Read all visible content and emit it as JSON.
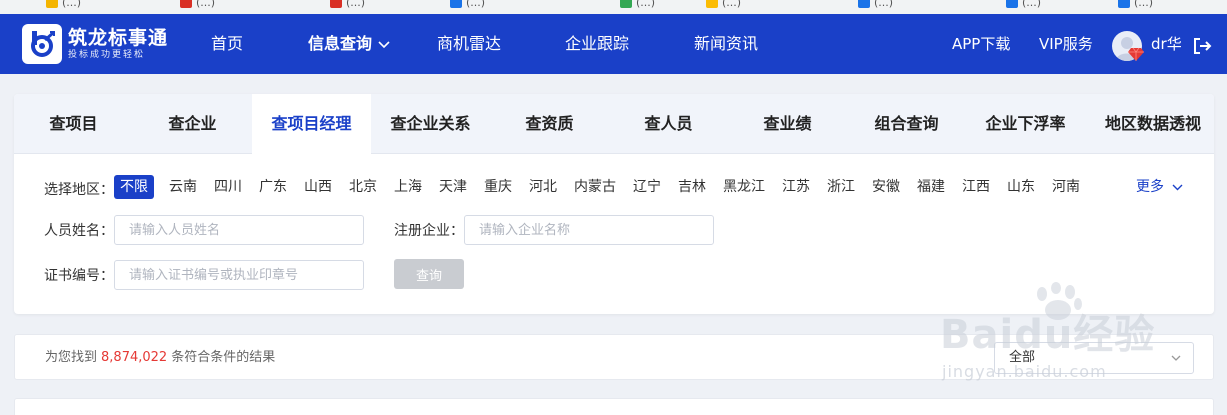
{
  "bookmarks": [
    {
      "label": "(...)",
      "color": "#f4b400"
    },
    {
      "label": "(...)",
      "color": "#d93025"
    },
    {
      "label": "(...)",
      "color": "#d93025"
    },
    {
      "label": "(...)",
      "color": "#1a73e8"
    },
    {
      "label": "(...)",
      "color": "#34a853"
    },
    {
      "label": "(...)",
      "color": "#fbbc04"
    },
    {
      "label": "(...)",
      "color": "#1a73e8"
    },
    {
      "label": "(...)",
      "color": "#1a73e8"
    },
    {
      "label": "(...)",
      "color": "#1a73e8"
    }
  ],
  "brand": {
    "title": "筑龙标事通",
    "subtitle": "投标成功更轻松",
    "color": "#1a40c8"
  },
  "nav": {
    "items": [
      "首页",
      "信息查询",
      "商机雷达",
      "企业跟踪",
      "新闻资讯"
    ],
    "active_index": 1,
    "app_download": "APP下载",
    "vip": "VIP服务",
    "username": "dr华",
    "logout_icon": "logout-icon"
  },
  "tabs": {
    "items": [
      "查项目",
      "查企业",
      "查项目经理",
      "查企业关系",
      "查资质",
      "查人员",
      "查业绩",
      "组合查询",
      "企业下浮率",
      "地区数据透视"
    ],
    "active_index": 2
  },
  "filters": {
    "region_label": "选择地区：",
    "regions": [
      "不限",
      "云南",
      "四川",
      "广东",
      "山西",
      "北京",
      "上海",
      "天津",
      "重庆",
      "河北",
      "内蒙古",
      "辽宁",
      "吉林",
      "黑龙江",
      "江苏",
      "浙江",
      "安徽",
      "福建",
      "江西",
      "山东",
      "河南"
    ],
    "selected_region": 0,
    "more_label": "更多",
    "name_label": "人员姓名：",
    "name_placeholder": "请输入人员姓名",
    "company_label": "注册企业：",
    "company_placeholder": "请输入企业名称",
    "cert_label": "证书编号：",
    "cert_placeholder": "请输入证书编号或执业印章号",
    "query_button": "查询"
  },
  "results": {
    "prefix": "为您找到",
    "count": "8,874,022",
    "suffix": "条符合条件的结果",
    "filter_value": "全部"
  },
  "watermark": {
    "text": "Baidu经验",
    "url": "jingyan.baidu.com"
  }
}
